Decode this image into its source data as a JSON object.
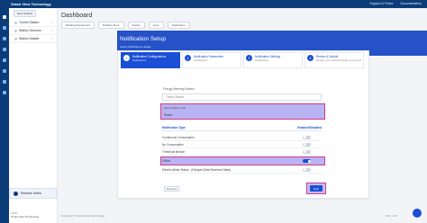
{
  "header": {
    "app_title": "Smart View Technology",
    "user_label": "Support & Fintox",
    "docs_label": "Documentation"
  },
  "sidebar": {
    "pill_label": "New Institute",
    "items": [
      {
        "label": "Tunnel Station"
      },
      {
        "label": "Station Sensors"
      },
      {
        "label": "Station Master"
      }
    ],
    "footer_label": "Release Notes",
    "bottom_lines": [
      "v 5.0",
      "Smart View Technology"
    ]
  },
  "main": {
    "title": "Dashboard",
    "toolbar": [
      "Building Department",
      "Building Floor",
      "Station",
      "Zone",
      "Notification"
    ],
    "banner": {
      "title": "Notification Setup",
      "subtitle": "Setup Notifications details"
    },
    "steps": [
      {
        "num": "1",
        "title": "Notification Configurations",
        "sub": "Notifications"
      },
      {
        "num": "2",
        "title": "Notification Parameters",
        "sub": "Notifications"
      },
      {
        "num": "3",
        "title": "Notification Settings",
        "sub": "Notifications"
      },
      {
        "num": "4",
        "title": "Review & Submit",
        "sub": "Review your selected details and submit"
      }
    ],
    "form": {
      "meeting_label": "Energy Metering System",
      "name_placeholder": "Tunnel Station",
      "select_label": "Select Meter Type",
      "select_value": "Select"
    },
    "table": {
      "col_type": "Notification Type",
      "col_enabled": "Enabled/Disabled",
      "rows": [
        {
          "label": "Continuous Consumption",
          "enabled": false
        },
        {
          "label": "No Consumption",
          "enabled": false
        },
        {
          "label": "Threshold Breach",
          "enabled": false
        },
        {
          "label": "Offline",
          "enabled": true
        },
        {
          "label": "Electric Meter Status - (Delayed Data Received State)",
          "enabled": false
        }
      ]
    },
    "buttons": {
      "previous": "Previous",
      "next": "Next"
    },
    "footer": {
      "copyright": "Copyright © Smart View Technology",
      "version": "v5.0 1.2.5"
    }
  }
}
